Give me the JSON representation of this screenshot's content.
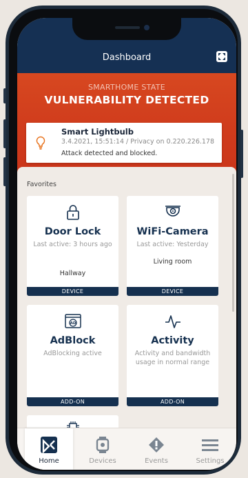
{
  "header": {
    "title": "Dashboard",
    "expand_icon": "expand-icon"
  },
  "state": {
    "label": "SMARTHOME STATE",
    "value": "VULNERABILITY DETECTED",
    "alert": {
      "icon": "lightbulb-icon",
      "title": "Smart Lightbulb",
      "meta": "3.4.2021, 15:51:14 / Privacy on 0.220.226.178",
      "detail": "Attack detected and blocked."
    }
  },
  "favorites": {
    "title": "Favorites",
    "cards": [
      {
        "icon": "lock-icon",
        "title": "Door Lock",
        "subtitle": "Last active: 3 hours ago",
        "room": "Hallway",
        "tag": "DEVICE"
      },
      {
        "icon": "camera-icon",
        "title": "WiFi-Camera",
        "subtitle": "Last active: Yesterday",
        "room": "Living room",
        "tag": "DEVICE"
      },
      {
        "icon": "adblock-icon",
        "title": "AdBlock",
        "subtitle": "AdBlocking active",
        "room": "",
        "tag": "ADD-ON"
      },
      {
        "icon": "activity-icon",
        "title": "Activity",
        "subtitle": "Activity and bandwidth usage in normal range",
        "room": "",
        "tag": "ADD-ON"
      }
    ],
    "partial_card_icon": "chip-icon"
  },
  "tabbar": {
    "items": [
      {
        "label": "Home",
        "icon": "home-icon"
      },
      {
        "label": "Devices",
        "icon": "watch-icon"
      },
      {
        "label": "Events",
        "icon": "alert-icon"
      },
      {
        "label": "Settings",
        "icon": "menu-icon"
      }
    ]
  },
  "colors": {
    "navy": "#15304f",
    "alert_red": "#cf3a1c",
    "background": "#f0ebe6"
  }
}
